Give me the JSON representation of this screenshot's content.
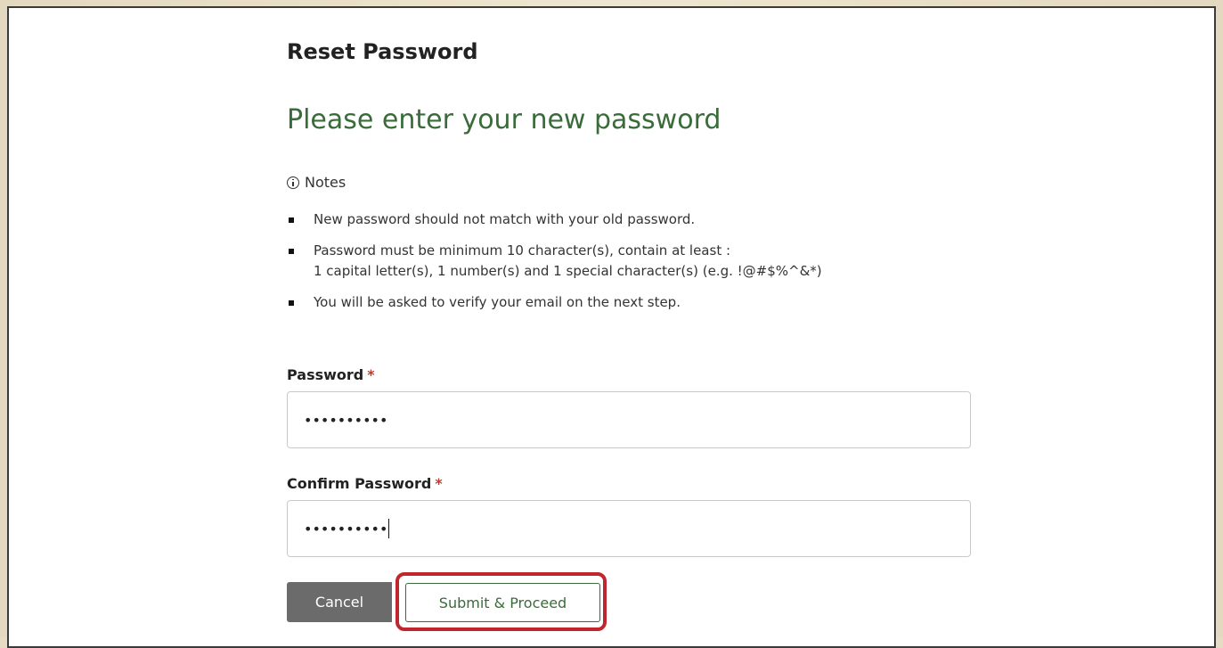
{
  "page": {
    "title": "Reset Password",
    "subtitle": "Please enter your new password"
  },
  "notes": {
    "heading": "Notes",
    "icon": "info-icon",
    "items": [
      {
        "line1": "New password should not match with your old password."
      },
      {
        "line1": "Password must be minimum 10 character(s), contain at least :",
        "line2": "1 capital letter(s), 1 number(s) and 1 special character(s) (e.g. !@#$%^&*)"
      },
      {
        "line1": "You will be asked to verify your email on the next step."
      }
    ]
  },
  "form": {
    "password": {
      "label": "Password",
      "required_mark": "*",
      "value": "••••••••••"
    },
    "confirm_password": {
      "label": "Confirm Password",
      "required_mark": "*",
      "value": "••••••••••"
    }
  },
  "actions": {
    "cancel_label": "Cancel",
    "submit_label": "Submit & Proceed"
  },
  "colors": {
    "accent_green": "#3a6b3a",
    "required_red": "#c0392b",
    "highlight_red": "#c0262e",
    "cancel_gray": "#6b6b6b"
  }
}
